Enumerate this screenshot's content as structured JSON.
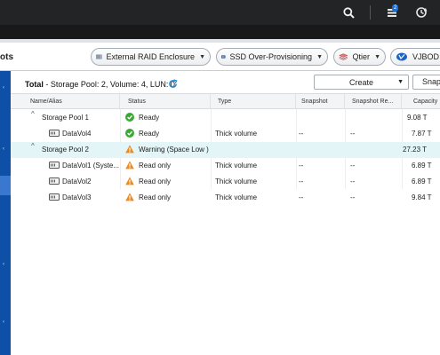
{
  "topbar": {
    "notification_count": "2",
    "icons": [
      "search-icon",
      "notification-icon",
      "resource-monitor-icon"
    ]
  },
  "header": {
    "title_fragment": "ots",
    "buttons": [
      {
        "label": "External RAID Enclosure",
        "icon": "raid-enclosure-icon"
      },
      {
        "label": "SSD Over-Provisioning",
        "icon": "ssd-icon"
      },
      {
        "label": "Qtier",
        "icon": "qtier-icon"
      },
      {
        "label": "VJBOD",
        "icon": "vjbod-icon"
      }
    ]
  },
  "toolbar": {
    "total_label": "Total",
    "total_detail": "- Storage Pool: 2, Volume: 4, LUN: 0",
    "create_label": "Create",
    "snapshot_label": "Snap"
  },
  "table": {
    "columns": [
      "Name/Alias",
      "Status",
      "Type",
      "Snapshot",
      "Snapshot Re...",
      "Capacity"
    ],
    "rows": [
      {
        "name": "Storage Pool 1",
        "kind": "pool",
        "status": "Ready",
        "status_kind": "ok",
        "type": "",
        "snapshot": "",
        "snapshot_re": "",
        "capacity": "9.08 T"
      },
      {
        "name": "DataVol4",
        "kind": "volume",
        "status": "Ready",
        "status_kind": "ok",
        "type": "Thick volume",
        "snapshot": "--",
        "snapshot_re": "--",
        "capacity": "7.87 T"
      },
      {
        "name": "Storage Pool 2",
        "kind": "pool",
        "status": "Warning (Space Low )",
        "status_kind": "warn",
        "type": "",
        "snapshot": "",
        "snapshot_re": "",
        "capacity": "27.23 T",
        "selected": true
      },
      {
        "name": "DataVol1 (Syste...",
        "kind": "volume",
        "status": "Read only",
        "status_kind": "warn",
        "type": "Thick volume",
        "snapshot": "--",
        "snapshot_re": "--",
        "capacity": "6.89 T"
      },
      {
        "name": "DataVol2",
        "kind": "volume",
        "status": "Read only",
        "status_kind": "warn",
        "type": "Thick volume",
        "snapshot": "--",
        "snapshot_re": "--",
        "capacity": "6.89 T"
      },
      {
        "name": "DataVol3",
        "kind": "volume",
        "status": "Read only",
        "status_kind": "warn",
        "type": "Thick volume",
        "snapshot": "--",
        "snapshot_re": "--",
        "capacity": "9.84 T"
      }
    ]
  },
  "colors": {
    "accent": "#0e4fa8",
    "ok": "#3aa935",
    "warn": "#f08a1c",
    "selected_row": "#e3f5f7"
  }
}
